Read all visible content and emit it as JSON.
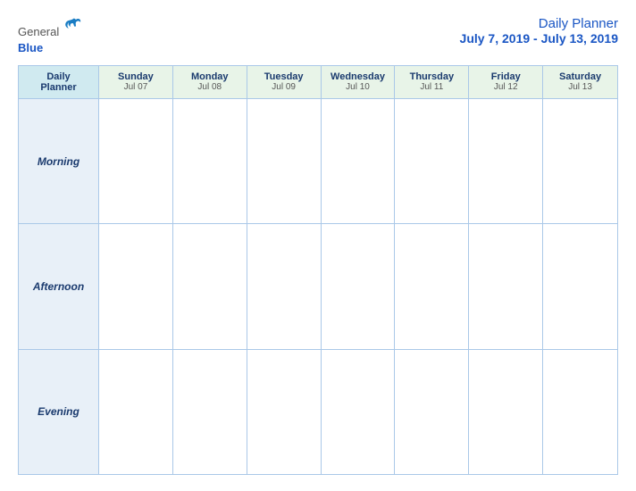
{
  "header": {
    "logo": {
      "general": "General",
      "blue": "Blue",
      "bird_symbol": "▶"
    },
    "title": "Daily Planner",
    "dates": "July 7, 2019 - July 13, 2019"
  },
  "calendar": {
    "label_header": {
      "line1": "Daily",
      "line2": "Planner"
    },
    "days": [
      {
        "name": "Sunday",
        "date": "Jul 07"
      },
      {
        "name": "Monday",
        "date": "Jul 08"
      },
      {
        "name": "Tuesday",
        "date": "Jul 09"
      },
      {
        "name": "Wednesday",
        "date": "Jul 10"
      },
      {
        "name": "Thursday",
        "date": "Jul 11"
      },
      {
        "name": "Friday",
        "date": "Jul 12"
      },
      {
        "name": "Saturday",
        "date": "Jul 13"
      }
    ],
    "rows": [
      {
        "label": "Morning"
      },
      {
        "label": "Afternoon"
      },
      {
        "label": "Evening"
      }
    ]
  }
}
